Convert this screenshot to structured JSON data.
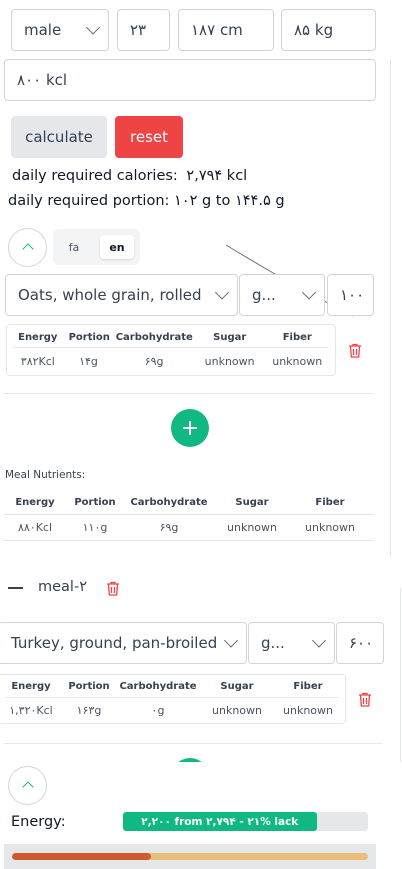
{
  "form": {
    "gender": "male",
    "age": "۲۳",
    "height": "۱۸۷ cm",
    "weight": "۸۵ kg",
    "calories_field": "۸۰۰ kcl",
    "calculate_label": "calculate",
    "reset_label": "reset"
  },
  "results": {
    "calories_label": "daily required calories:",
    "calories_value": "۲,۷۹۴  kcl",
    "portion_label": "daily required portion:",
    "portion_value": "۱۰۲ g to  ۱۴۴.۵ g"
  },
  "lang": {
    "fa": "fa",
    "en": "en",
    "active": "en"
  },
  "meal1": {
    "food": "Oats, whole grain, rolled",
    "unit": "g...",
    "amount": "۱۰۰",
    "headers": [
      "Energy",
      "Portion",
      "Carbohydrate",
      "Sugar",
      "Fiber"
    ],
    "row": [
      "۳۸۲Kcl",
      "۱۴g",
      "۶۹g",
      "unknown",
      "unknown"
    ]
  },
  "meal_nutrients": {
    "label": "Meal Nutrients:",
    "headers": [
      "Energy",
      "Portion",
      "Carbohydrate",
      "Sugar",
      "Fiber"
    ],
    "row": [
      "۸۸۰Kcl",
      "۱۱۰g",
      "۶۹g",
      "unknown",
      "unknown"
    ]
  },
  "meal2": {
    "title": "meal-۲",
    "food": "Turkey, ground, pan-broiled",
    "unit": "g...",
    "amount": "۶۰۰",
    "headers": [
      "Energy",
      "Portion",
      "Carbohydrate",
      "Sugar",
      "Fiber"
    ],
    "row": [
      "۱,۳۲۰Kcl",
      "۱۶۳g",
      "۰g",
      "unknown",
      "unknown"
    ]
  },
  "summary": {
    "energy_label": "Energy:",
    "energy_text": "۲,۲۰۰ from ۲,۷۹۴ - ۲۱% lack",
    "energy_fraction": 0.79,
    "macro_fraction": 0.39
  },
  "colors": {
    "accent": "#10b981",
    "danger": "#ef4444",
    "button_gray": "#e5e7eb",
    "bar_track": "#e5e7eb",
    "macro_dark": "#d05a2e",
    "macro_light": "#e8c07a"
  }
}
